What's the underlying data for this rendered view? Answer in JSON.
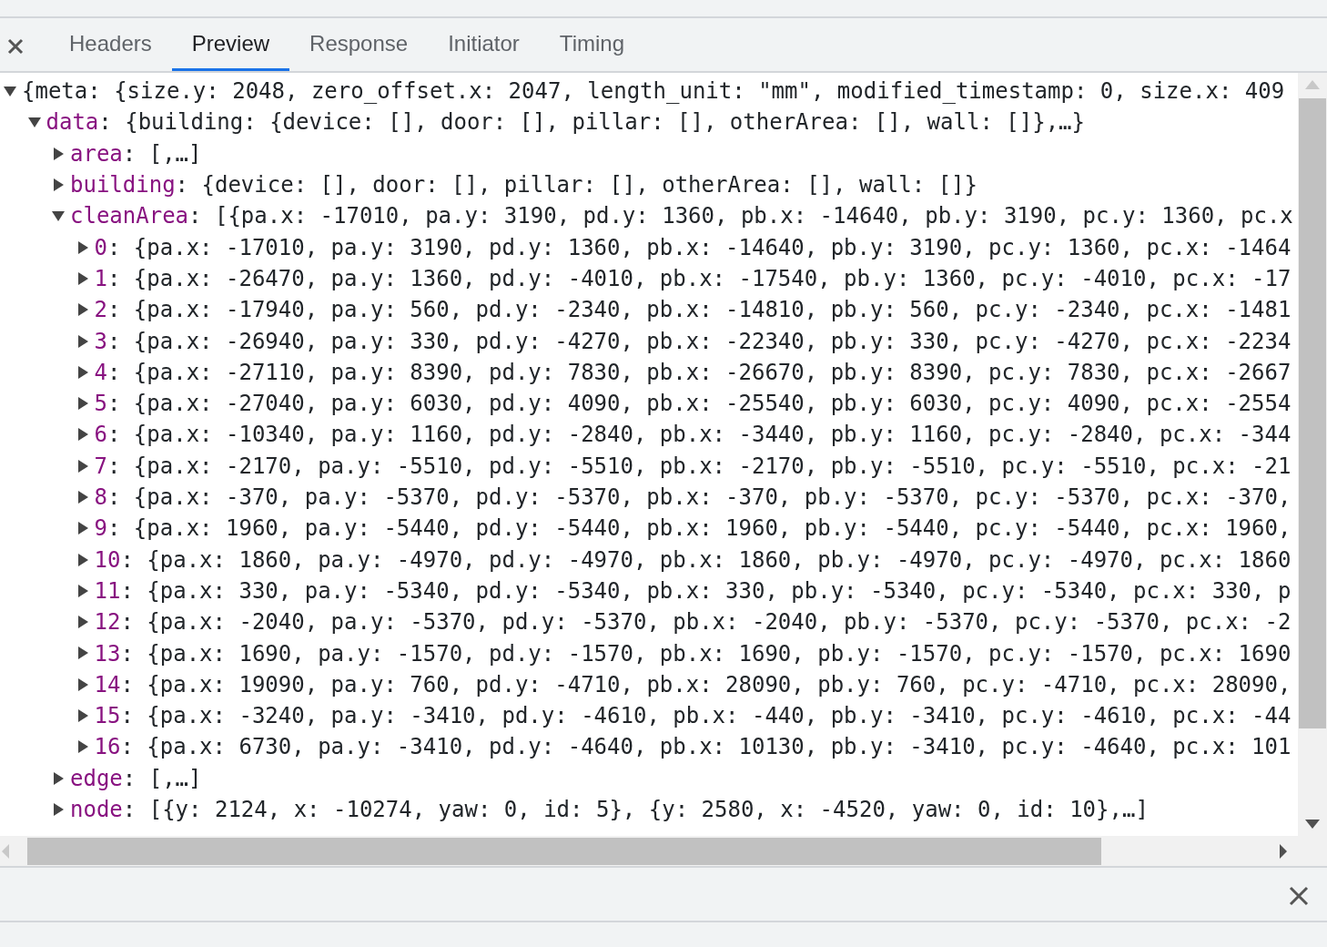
{
  "tabs": [
    {
      "label": "Headers",
      "selected": false
    },
    {
      "label": "Preview",
      "selected": true
    },
    {
      "label": "Response",
      "selected": false
    },
    {
      "label": "Initiator",
      "selected": false
    },
    {
      "label": "Timing",
      "selected": false
    }
  ],
  "tree": [
    {
      "value": "{meta: {size.y: 2048, zero_offset.x: 2047, length_unit: \"mm\", modified_timestamp: 0, size.x: 409",
      "expanded": true,
      "children": [
        {
          "key": "data",
          "value": ": {building: {device: [], door: [], pillar: [], otherArea: [], wall: []},…}",
          "expanded": true,
          "children": [
            {
              "key": "area",
              "value": ": [,…]",
              "expanded": false
            },
            {
              "key": "building",
              "value": ": {device: [], door: [], pillar: [], otherArea: [], wall: []}",
              "expanded": false
            },
            {
              "key": "cleanArea",
              "value": ": [{pa.x: -17010, pa.y: 3190, pd.y: 1360, pb.x: -14640, pb.y: 3190, pc.y: 1360, pc.x",
              "expanded": true,
              "children": [
                {
                  "key": "0",
                  "value": ": {pa.x: -17010, pa.y: 3190, pd.y: 1360, pb.x: -14640, pb.y: 3190, pc.y: 1360, pc.x: -1464",
                  "expanded": false
                },
                {
                  "key": "1",
                  "value": ": {pa.x: -26470, pa.y: 1360, pd.y: -4010, pb.x: -17540, pb.y: 1360, pc.y: -4010, pc.x: -17",
                  "expanded": false
                },
                {
                  "key": "2",
                  "value": ": {pa.x: -17940, pa.y: 560, pd.y: -2340, pb.x: -14810, pb.y: 560, pc.y: -2340, pc.x: -1481",
                  "expanded": false
                },
                {
                  "key": "3",
                  "value": ": {pa.x: -26940, pa.y: 330, pd.y: -4270, pb.x: -22340, pb.y: 330, pc.y: -4270, pc.x: -2234",
                  "expanded": false
                },
                {
                  "key": "4",
                  "value": ": {pa.x: -27110, pa.y: 8390, pd.y: 7830, pb.x: -26670, pb.y: 8390, pc.y: 7830, pc.x: -2667",
                  "expanded": false
                },
                {
                  "key": "5",
                  "value": ": {pa.x: -27040, pa.y: 6030, pd.y: 4090, pb.x: -25540, pb.y: 6030, pc.y: 4090, pc.x: -2554",
                  "expanded": false
                },
                {
                  "key": "6",
                  "value": ": {pa.x: -10340, pa.y: 1160, pd.y: -2840, pb.x: -3440, pb.y: 1160, pc.y: -2840, pc.x: -344",
                  "expanded": false
                },
                {
                  "key": "7",
                  "value": ": {pa.x: -2170, pa.y: -5510, pd.y: -5510, pb.x: -2170, pb.y: -5510, pc.y: -5510, pc.x: -21",
                  "expanded": false
                },
                {
                  "key": "8",
                  "value": ": {pa.x: -370, pa.y: -5370, pd.y: -5370, pb.x: -370, pb.y: -5370, pc.y: -5370, pc.x: -370,",
                  "expanded": false
                },
                {
                  "key": "9",
                  "value": ": {pa.x: 1960, pa.y: -5440, pd.y: -5440, pb.x: 1960, pb.y: -5440, pc.y: -5440, pc.x: 1960,",
                  "expanded": false
                },
                {
                  "key": "10",
                  "value": ": {pa.x: 1860, pa.y: -4970, pd.y: -4970, pb.x: 1860, pb.y: -4970, pc.y: -4970, pc.x: 1860",
                  "expanded": false
                },
                {
                  "key": "11",
                  "value": ": {pa.x: 330, pa.y: -5340, pd.y: -5340, pb.x: 330, pb.y: -5340, pc.y: -5340, pc.x: 330, p",
                  "expanded": false
                },
                {
                  "key": "12",
                  "value": ": {pa.x: -2040, pa.y: -5370, pd.y: -5370, pb.x: -2040, pb.y: -5370, pc.y: -5370, pc.x: -2",
                  "expanded": false
                },
                {
                  "key": "13",
                  "value": ": {pa.x: 1690, pa.y: -1570, pd.y: -1570, pb.x: 1690, pb.y: -1570, pc.y: -1570, pc.x: 1690",
                  "expanded": false
                },
                {
                  "key": "14",
                  "value": ": {pa.x: 19090, pa.y: 760, pd.y: -4710, pb.x: 28090, pb.y: 760, pc.y: -4710, pc.x: 28090,",
                  "expanded": false
                },
                {
                  "key": "15",
                  "value": ": {pa.x: -3240, pa.y: -3410, pd.y: -4610, pb.x: -440, pb.y: -3410, pc.y: -4610, pc.x: -44",
                  "expanded": false
                },
                {
                  "key": "16",
                  "value": ": {pa.x: 6730, pa.y: -3410, pd.y: -4640, pb.x: 10130, pb.y: -3410, pc.y: -4640, pc.x: 101",
                  "expanded": false
                }
              ]
            },
            {
              "key": "edge",
              "value": ": [,…]",
              "expanded": false
            },
            {
              "key": "node",
              "value": ": [{y: 2124, x: -10274, yaw: 0, id: 5}, {y: 2580, x: -4520, yaw: 0, id: 10},…]",
              "expanded": false
            }
          ]
        }
      ]
    }
  ]
}
